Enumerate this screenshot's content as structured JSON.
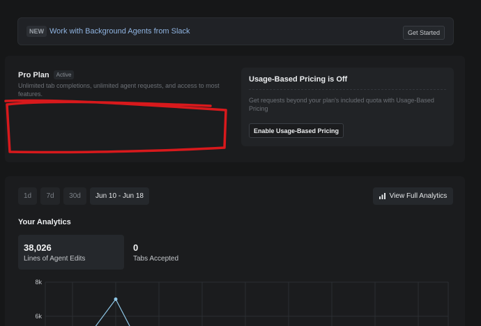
{
  "banner": {
    "badge": "NEW",
    "text": "Work with Background Agents from Slack",
    "button": "Get Started"
  },
  "plan": {
    "title": "Pro Plan",
    "status": "Active",
    "description": "Unlimited tab completions, unlimited agent requests, and access to most features."
  },
  "usage_pricing": {
    "title": "Usage-Based Pricing is Off",
    "description": "Get requests beyond your plan's included quota with Usage-Based Pricing",
    "button": "Enable Usage-Based Pricing"
  },
  "analytics": {
    "ranges": [
      "1d",
      "7d",
      "30d"
    ],
    "date_range": "Jun 10 - Jun 18",
    "view_full": "View Full Analytics",
    "title": "Your Analytics",
    "stats": [
      {
        "value": "38,026",
        "label": "Lines of Agent Edits"
      },
      {
        "value": "0",
        "label": "Tabs Accepted"
      }
    ]
  },
  "chart_data": {
    "type": "line",
    "y_ticks": [
      "8k",
      "6k"
    ],
    "ylim": [
      4000,
      8000
    ],
    "series": [
      {
        "values": [
          null,
          null,
          null,
          7000,
          null
        ]
      }
    ],
    "colors": {
      "line": "#8ec6e6",
      "grid": "#2b2e32"
    }
  },
  "icons": {
    "analytics": "bar-chart-icon"
  }
}
